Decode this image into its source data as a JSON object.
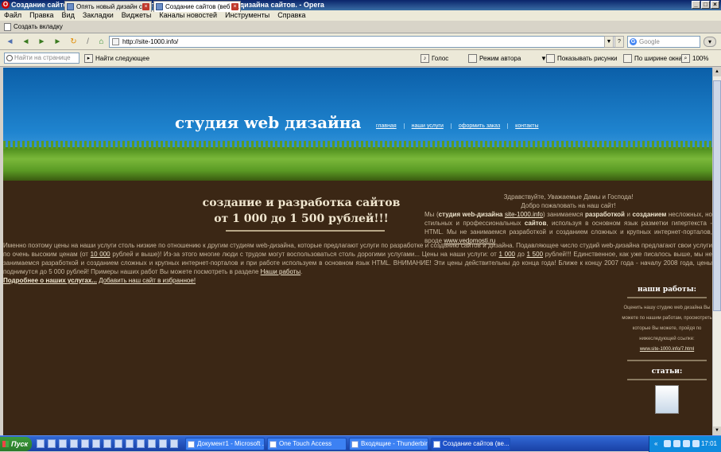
{
  "window": {
    "title": "Создание сайтов (веб (web) сайтов), изготовление (разработка) дизайна сайтов. - Opera",
    "app_icon_glyph": "O"
  },
  "menu": [
    "Файл",
    "Правка",
    "Вид",
    "Закладки",
    "Виджеты",
    "Каналы новостей",
    "Инструменты",
    "Справка"
  ],
  "tabs": {
    "new_tab_label": "Создать вкладку",
    "items": [
      {
        "label": "Опять новый дизайн ст...",
        "active": false
      },
      {
        "label": "Создание сайтов (веб (...",
        "active": true
      }
    ]
  },
  "navbar": {
    "address": "http://site-1000.info/",
    "search_placeholder": "Google"
  },
  "findbar": {
    "find_placeholder": "Найти на странице",
    "find_next": "Найти следующее",
    "voice": "Голос",
    "author_mode": "Режим автора",
    "show_images": "Показывать рисунки",
    "fit_width": "По ширине окна",
    "zoom": "100%"
  },
  "page": {
    "brand": "студия web дизайна",
    "nav": [
      "главная",
      "наши услуги",
      "оформить заказ",
      "контакты"
    ],
    "hero_line1": "создание и разработка сайтов",
    "hero_line2": "от 1 000 до 1 500 рублей!!!",
    "greet_line1": "Здравствуйте, Уважаемые Дамы и Господа!",
    "greet_line2": "Добро пожаловать на наш сайт!",
    "greet_p_a": "Мы (",
    "greet_p_b": "студия web-дизайна",
    "greet_p_c": "site-1000.info",
    "greet_p_d": ") занимаемся",
    "greet_p_e": "разработкой",
    "greet_p_f": "и",
    "greet_p_g": "созданием",
    "greet_p_h": "несложных, но стильных и профессиональных",
    "greet_p_i": "сайтов",
    "greet_p_j": ", используя в основном язык разметки гипертекста - HTML. Мы не занимаемся разработкой и созданием сложных и крупных интернет-порталов, вроде",
    "greet_p_k": "www.vedomosti.ru",
    "body_1": "Именно поэтому цены на наши услуги столь низкие по отношению к другим студиям web-дизайна, которые предлагают услуги по разработке и созданию сайтов и дизайна. Подавляющее число студий web-дизайна предлагают свои услуги по очень высоким ценам (от",
    "body_2": "10 000",
    "body_3": "рублей и выше)! Из-за этого многие люди с трудом могут воспользоваться столь дорогими услугами... Цены на наши услуги: от",
    "body_4": "1 000",
    "body_5": "до",
    "body_6": "1 500",
    "body_7": "рублей!!! Единственное, как уже писалось выше, мы не занимаемся разработкой и созданием сложных и крупных интернет-порталов и при работе используем в основном язык HTML. ВНИМАНИЕ! Эти цены действительны до конца года! Ближе к концу 2007 года - началу 2008 года, цены поднимутся до 5 000 рублей! Примеры наших работ Вы можете посмотреть в разделе",
    "body_8": "Наши работы",
    "body_9": ".",
    "body_more": "Подробнее о наших услугах...",
    "body_fav": "Добавить наш сайт в избранное!",
    "sidebar_works_title": "наши работы:",
    "sidebar_works_text": "Оценить нашу студию web дизайна Вы можете по нашим работам, просмотреть которые Вы можете, пройдя по нижеследующей ссылке:",
    "sidebar_works_link": "www.site-1000.info/7.html",
    "sidebar_articles_title": "статьи:"
  },
  "taskbar": {
    "start": "Пуск",
    "buttons": [
      {
        "label": "Документ1 - Microsoft ...",
        "active": false
      },
      {
        "label": "One Touch Access",
        "active": false
      },
      {
        "label": "Входящие - Thunderbird",
        "active": false
      },
      {
        "label": "Создание сайтов (ве...",
        "active": true
      }
    ],
    "tray_arrow": "«",
    "clock": "17:01"
  }
}
